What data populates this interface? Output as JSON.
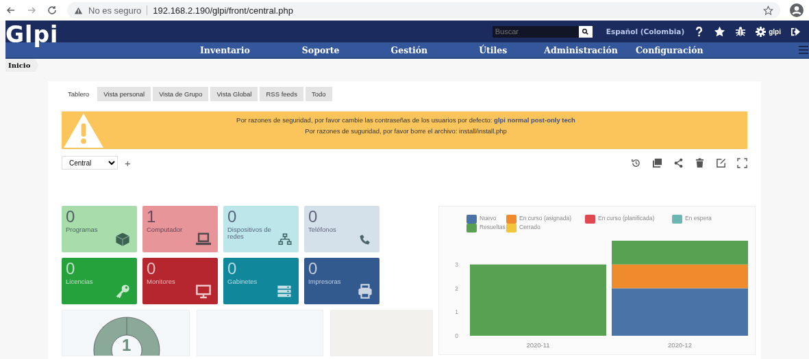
{
  "browser": {
    "security": "No es seguro",
    "url": "192.168.2.190/glpi/front/central.php"
  },
  "header": {
    "logo": "Glpi",
    "search": {
      "placeholder": "Buscar"
    },
    "language": "Español (Colombia)",
    "user": "glpi",
    "menu": [
      "Inventario",
      "Soporte",
      "Gestión",
      "Útiles",
      "Administración",
      "Configuración"
    ]
  },
  "breadcrumb": "Inicio",
  "tabs": [
    {
      "label": "Tablero",
      "selected": true
    },
    {
      "label": "Vista personal",
      "selected": false
    },
    {
      "label": "Vista de Grupo",
      "selected": false
    },
    {
      "label": "Vista Global",
      "selected": false
    },
    {
      "label": "RSS feeds",
      "selected": false
    },
    {
      "label": "Todo",
      "selected": false
    }
  ],
  "warning": {
    "lines": [
      "Por razones de seguridad, por favor cambie las contraseñas de los usuarios por defecto: **glpi normal post-only tech**",
      "Por razones de suguridad, por favor borre el archivo: install/install.php"
    ]
  },
  "dashboard": {
    "value": "Central",
    "add": "+"
  },
  "tiles": [
    {
      "count": "0",
      "label": "Programas",
      "color": "#a8dcab"
    },
    {
      "count": "1",
      "label": "Computador",
      "color": "#e8959a"
    },
    {
      "count": "0",
      "label": "Dispositivos de redes",
      "color": "#bde6ea"
    },
    {
      "count": "0",
      "label": "Teléfonos",
      "color": "#d5e1ea"
    },
    {
      "count": "0",
      "label": "Licencias",
      "color": "#25a23c"
    },
    {
      "count": "0",
      "label": "Monitores",
      "color": "#b5262e"
    },
    {
      "count": "0",
      "label": "Gabinetes",
      "color": "#10879b"
    },
    {
      "count": "0",
      "label": "Impresoras",
      "color": "#325a8f"
    }
  ],
  "donut": {
    "value": "1"
  },
  "chart": {
    "chart_data": {
      "type": "bar",
      "stacked": true,
      "legend": true,
      "categories": [
        "2020-11",
        "2020-12"
      ],
      "ylim": [
        0,
        4
      ],
      "yticks": [
        0,
        1,
        2,
        3
      ],
      "series": [
        {
          "name": "Nuevo",
          "color": "#4a74a8",
          "values": [
            0,
            2
          ]
        },
        {
          "name": "En curso (asignada)",
          "color": "#f08b2d",
          "values": [
            0,
            1
          ]
        },
        {
          "name": "En curso (planificada)",
          "color": "#e0474f",
          "values": [
            0,
            0
          ]
        },
        {
          "name": "En espera",
          "color": "#6cb7b3",
          "values": [
            0,
            0
          ]
        },
        {
          "name": "Resueltas",
          "color": "#58a052",
          "values": [
            3,
            1
          ]
        },
        {
          "name": "Cerrado",
          "color": "#f2c53a",
          "values": [
            0,
            0
          ]
        }
      ]
    }
  }
}
